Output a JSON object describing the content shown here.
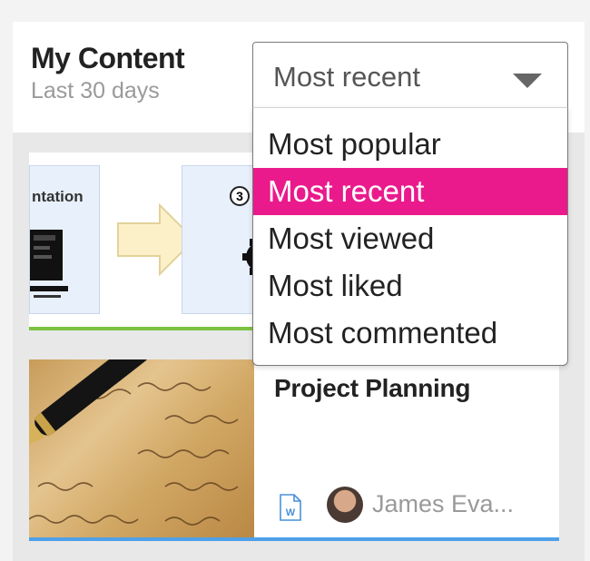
{
  "header": {
    "title": "My Content",
    "subtitle": "Last 30 days"
  },
  "sort_select": {
    "value": "Most recent",
    "options": [
      "Most popular",
      "Most recent",
      "Most viewed",
      "Most liked",
      "Most commented"
    ],
    "selected_index": 1,
    "highlight_color": "#ea1a8c"
  },
  "cards": [
    {
      "thumbnail_text": "ntation",
      "step_number": "3",
      "bar_color": "#7cc242"
    },
    {
      "title": "Project Planning",
      "file_icon": "word-document-icon",
      "author": "James Eva...",
      "bar_color": "#4ea0e8"
    }
  ]
}
